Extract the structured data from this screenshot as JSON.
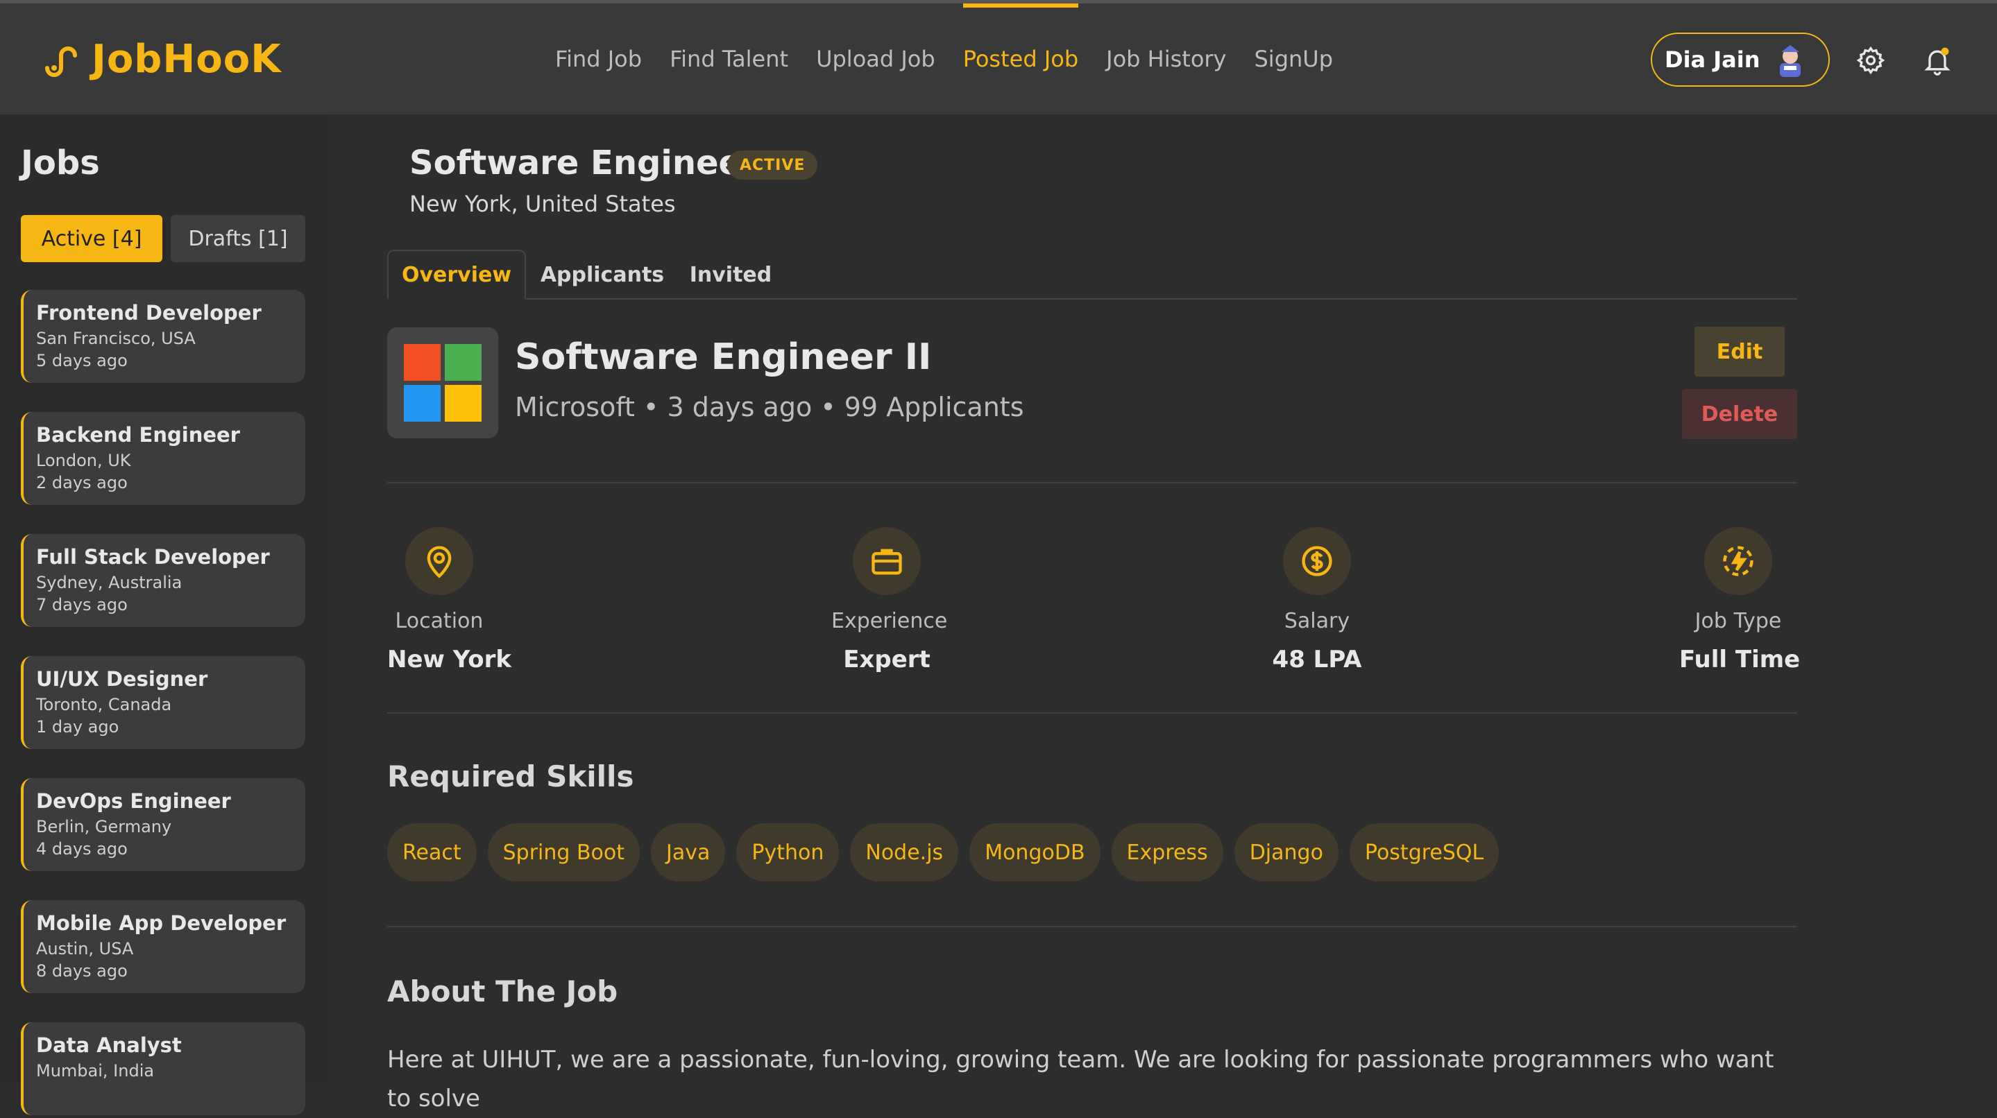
{
  "brand": {
    "name": "JobHooK",
    "accent": "#f6b715"
  },
  "nav": {
    "items": [
      "Find Job",
      "Find Talent",
      "Upload Job",
      "Posted Job",
      "Job History",
      "SignUp"
    ],
    "active": "Posted Job"
  },
  "user": {
    "name": "Dia Jain"
  },
  "header_icons": [
    "gear-icon",
    "bell-icon"
  ],
  "sidebar": {
    "title": "Jobs",
    "tab_active": "Active [4]",
    "tab_drafts": "Drafts [1]",
    "jobs": [
      {
        "title": "Frontend Developer",
        "location": "San Francisco, USA",
        "ago": "5 days ago"
      },
      {
        "title": "Backend Engineer",
        "location": "London, UK",
        "ago": "2 days ago"
      },
      {
        "title": "Full Stack Developer",
        "location": "Sydney, Australia",
        "ago": "7 days ago"
      },
      {
        "title": "UI/UX Designer",
        "location": "Toronto, Canada",
        "ago": "1 day ago"
      },
      {
        "title": "DevOps Engineer",
        "location": "Berlin, Germany",
        "ago": "4 days ago"
      },
      {
        "title": "Mobile App Developer",
        "location": "Austin, USA",
        "ago": "8 days ago"
      },
      {
        "title": "Data Analyst",
        "location": "Mumbai, India",
        "ago": ""
      }
    ]
  },
  "job": {
    "title": "Software Engineer",
    "badge": "ACTIVE",
    "location": "New York, United States",
    "tabs": [
      "Overview",
      "Applicants",
      "Invited"
    ],
    "role_title": "Software Engineer II",
    "role_meta": "Microsoft • 3 days ago • 99 Applicants",
    "edit_label": "Edit",
    "delete_label": "Delete",
    "stats": [
      {
        "icon": "location-pin-icon",
        "label": "Location",
        "value": "New York"
      },
      {
        "icon": "briefcase-icon",
        "label": "Experience",
        "value": "Expert"
      },
      {
        "icon": "dollar-icon",
        "label": "Salary",
        "value": "48 LPA"
      },
      {
        "icon": "lightning-icon",
        "label": "Job Type",
        "value": "Full Time"
      }
    ],
    "skills_title": "Required Skills",
    "skills": [
      "React",
      "Spring Boot",
      "Java",
      "Python",
      "Node.js",
      "MongoDB",
      "Express",
      "Django",
      "PostgreSQL"
    ],
    "about_title": "About The Job",
    "about_text": "Here at UIHUT, we are a passionate, fun-loving, growing team. We are looking for passionate programmers who want to solve"
  }
}
